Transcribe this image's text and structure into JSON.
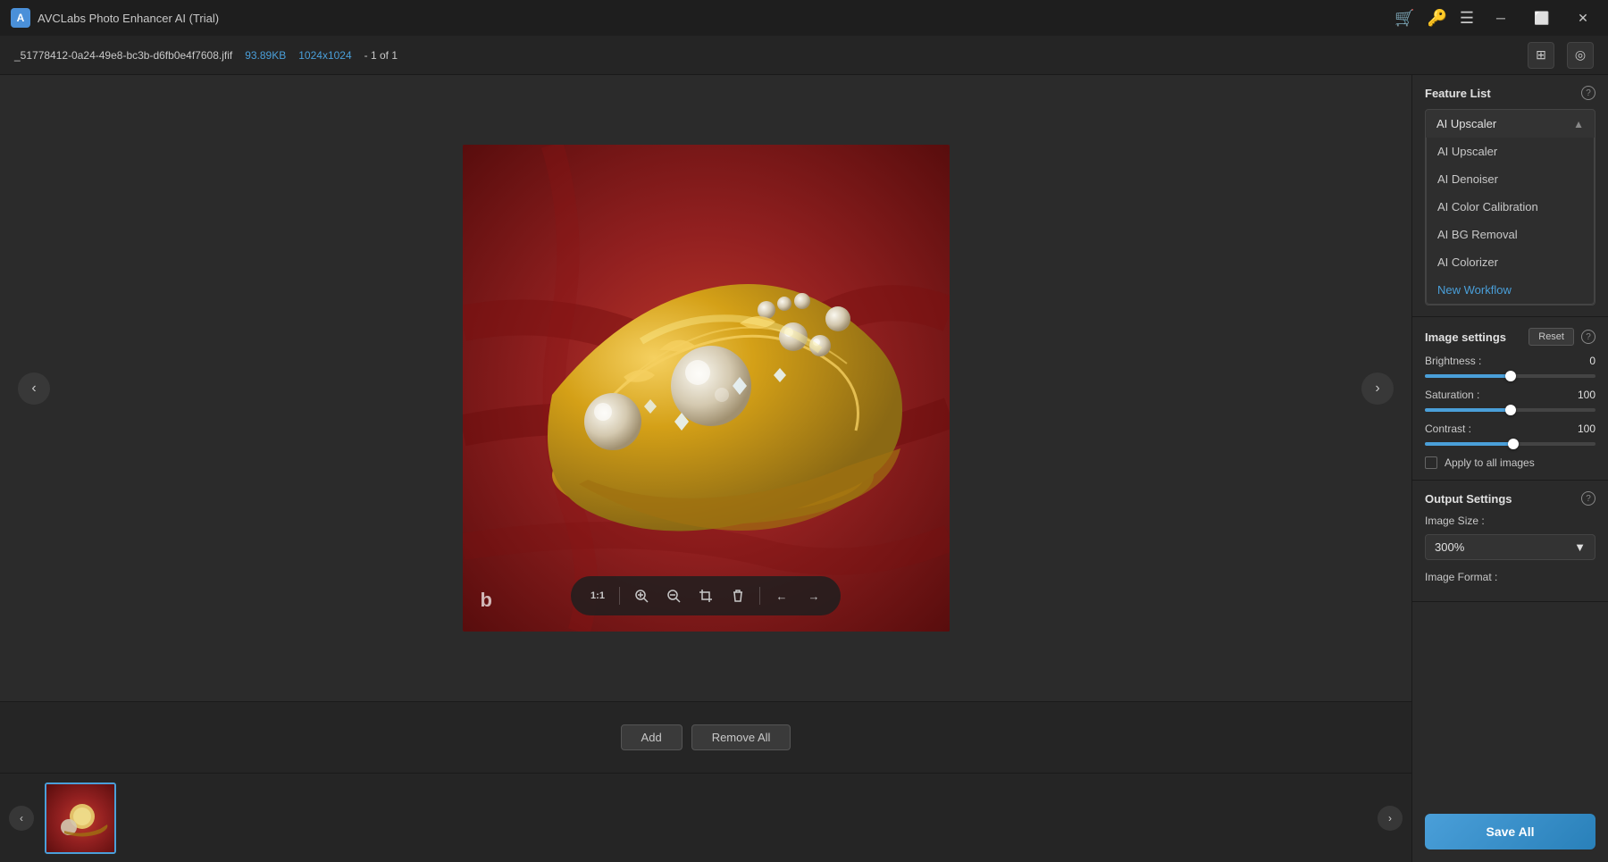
{
  "titleBar": {
    "appName": "AVCLabs Photo Enhancer AI (Trial)",
    "logoText": "A",
    "icons": {
      "cart": "🛒",
      "key": "🔑",
      "menu": "☰",
      "minimize": "─",
      "maximize": "⬜",
      "close": "✕"
    }
  },
  "topBar": {
    "fileName": "_51778412-0a24-49e8-bc3b-d6fb0e4f7608.jfif",
    "fileSize": "93.89KB",
    "fileDimensions": "1024x1024",
    "fileCount": "- 1 of 1"
  },
  "toolbar": {
    "ratio": "1:1",
    "zoomIn": "+",
    "zoomOut": "−",
    "crop": "⬜",
    "delete": "🗑",
    "prev": "←",
    "next": "→"
  },
  "bottomBar": {
    "addLabel": "Add",
    "removeAllLabel": "Remove All"
  },
  "featureList": {
    "title": "Feature List",
    "selectedFeature": "AI Upscaler",
    "items": [
      {
        "label": "AI Upscaler"
      },
      {
        "label": "AI Denoiser"
      },
      {
        "label": "AI Color Calibration"
      },
      {
        "label": "AI BG Removal"
      },
      {
        "label": "AI Colorizer"
      },
      {
        "label": "New Workflow",
        "isNew": true
      }
    ]
  },
  "imageSettings": {
    "title": "Image settings",
    "resetLabel": "Reset",
    "brightness": {
      "label": "Brightness :",
      "value": "0",
      "percent": 50
    },
    "saturation": {
      "label": "Saturation :",
      "value": "100",
      "percent": 50
    },
    "contrast": {
      "label": "Contrast :",
      "value": "100",
      "percent": 52
    },
    "applyToAll": "Apply to all images"
  },
  "outputSettings": {
    "title": "Output Settings",
    "imageSizeLabel": "Image Size :",
    "imageSizeValue": "300%",
    "imageFormatLabel": "Image Format :",
    "saveAll": "Save All"
  }
}
